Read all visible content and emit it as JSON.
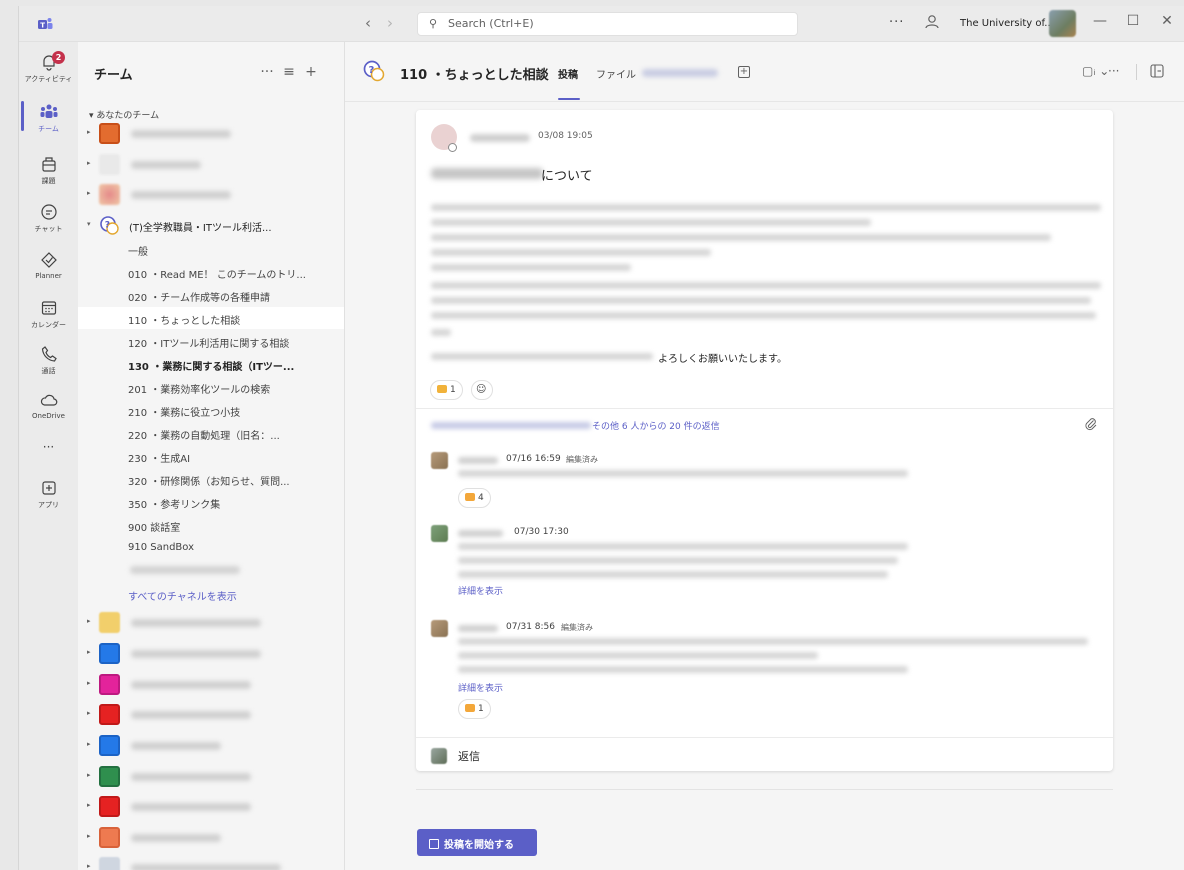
{
  "titlebar": {
    "search_placeholder": "Search (Ctrl+E)",
    "more_label": "···",
    "org_name": "The University of...",
    "back_glyph": "‹",
    "forward_glyph": "›",
    "minimize_glyph": "—",
    "maximize_glyph": "☐",
    "close_glyph": "✕"
  },
  "rail": {
    "activity_badge": "2",
    "items": [
      {
        "label": "アクティビティ",
        "icon": "bell-icon"
      },
      {
        "label": "チーム",
        "icon": "teams-icon"
      },
      {
        "label": "課題",
        "icon": "assignments-icon"
      },
      {
        "label": "チャット",
        "icon": "chat-icon"
      },
      {
        "label": "Planner",
        "icon": "planner-icon"
      },
      {
        "label": "カレンダー",
        "icon": "calendar-icon"
      },
      {
        "label": "通話",
        "icon": "phone-icon"
      },
      {
        "label": "OneDrive",
        "icon": "cloud-icon"
      },
      {
        "label": "···",
        "icon": "more-icon"
      },
      {
        "label": "アプリ",
        "icon": "apps-icon"
      }
    ]
  },
  "sidebar": {
    "title": "チーム",
    "tools": {
      "more": "···",
      "filter": "≡",
      "add": "+"
    },
    "your_teams": "▾ あなたのチーム",
    "expanded_team": "(T)全学教職員・ITツール利活...",
    "channels": [
      "一般",
      "010 ・Read ME！ このチームのトリ...",
      "020 ・チーム作成等の各種申請",
      "110 ・ちょっとした相談",
      "120 ・ITツール利活用に関する相談",
      "130 ・業務に関する相談（ITツー...",
      "201 ・業務効率化ツールの検索",
      "210 ・業務に役立つ小技",
      "220 ・業務の自動処理（旧名：...",
      "230 ・生成AI",
      "320 ・研修関係（お知らせ、質問...",
      "350 ・参考リンク集",
      "900 談話室",
      "910 SandBox"
    ],
    "show_all": "すべてのチャネルを表示",
    "colors": {
      "accent": "#5b5fc7",
      "selected_bg": "#ffffff"
    }
  },
  "channel": {
    "title": "110 ・ちょっとした相談",
    "tab_posts": "投稿",
    "tab_files": "ファイル",
    "add_tab": "+",
    "video_label": "▢ᵢ ⌄",
    "more_label": "···"
  },
  "post": {
    "timestamp": "03/08 19:05",
    "subject_suffix": "について",
    "closing": "よろしくお願いいたします。",
    "reaction_count": "1",
    "replies_summary": "その他 6 人からの 20 件の返信",
    "replies": [
      {
        "time": "07/16 16:59",
        "edited": "編集済み",
        "reaction": "4"
      },
      {
        "time": "07/30 17:30",
        "show_more": "詳細を表示"
      },
      {
        "time": "07/31 8:56",
        "edited": "編集済み",
        "show_more": "詳細を表示",
        "reaction": "1"
      }
    ],
    "reply_label": "返信"
  },
  "compose": {
    "new_post": "投稿を開始する"
  }
}
